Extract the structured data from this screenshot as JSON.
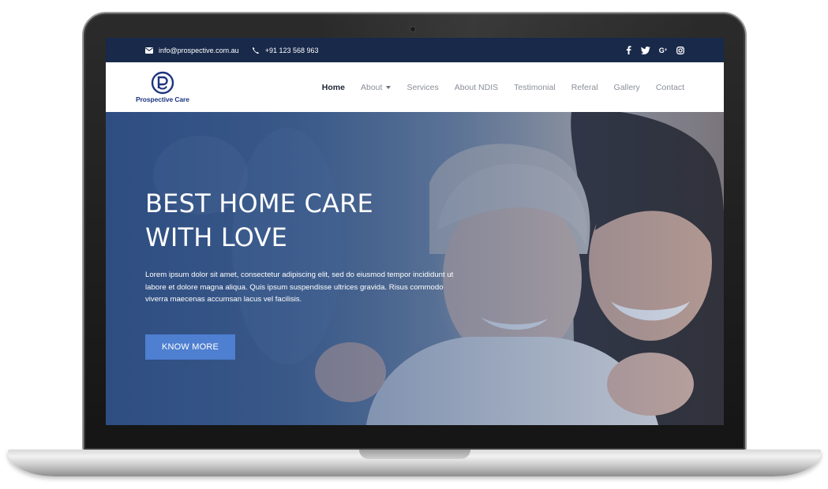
{
  "topbar": {
    "email": "info@prospective.com.au",
    "phone": "+91 123 568 963",
    "social": [
      {
        "name": "facebook-icon",
        "glyph": "f"
      },
      {
        "name": "twitter-icon",
        "glyph": "🐦"
      },
      {
        "name": "google-plus-icon",
        "glyph": "G+"
      },
      {
        "name": "instagram-icon",
        "glyph": "◎"
      }
    ]
  },
  "brand": {
    "name": "Prospective Care",
    "color": "#1c3580"
  },
  "nav": {
    "items": [
      {
        "label": "Home",
        "active": true
      },
      {
        "label": "About",
        "dropdown": true
      },
      {
        "label": "Services"
      },
      {
        "label": "About NDIS"
      },
      {
        "label": "Testimonial"
      },
      {
        "label": "Referal"
      },
      {
        "label": "Gallery"
      },
      {
        "label": "Contact"
      }
    ]
  },
  "hero": {
    "title": "BEST HOME CARE\nWITH LOVE",
    "text": "Lorem ipsum dolor sit amet, consectetur adipiscing elit, sed do eiusmod tempor incididunt ut labore et dolore magna aliqua. Quis ipsum suspendisse ultrices gravida. Risus commodo viverra maecenas accumsan lacus vel facilisis.",
    "button_label": "KNOW MORE"
  },
  "colors": {
    "topbar_bg": "#18294a",
    "accent": "#4e7fd0"
  }
}
